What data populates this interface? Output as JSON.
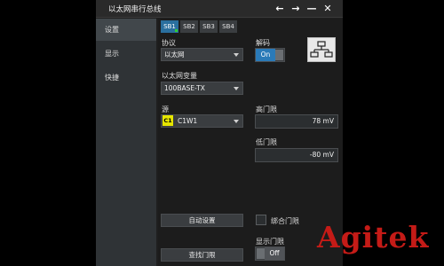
{
  "window": {
    "title": "以太网串行总线",
    "controls": [
      "←",
      "→",
      "—",
      "✕"
    ]
  },
  "nav": {
    "items": [
      {
        "label": "设置",
        "active": true
      },
      {
        "label": "显示",
        "active": false
      },
      {
        "label": "快捷",
        "active": false
      }
    ]
  },
  "tabs": [
    {
      "label": "SB1",
      "active": true
    },
    {
      "label": "SB2",
      "active": false
    },
    {
      "label": "SB3",
      "active": false
    },
    {
      "label": "SB4",
      "active": false
    }
  ],
  "protocol": {
    "label": "协议",
    "value": "以太网"
  },
  "decode": {
    "label": "解码",
    "state": "On"
  },
  "variant": {
    "label": "以太网变量",
    "value": "100BASE-TX"
  },
  "source": {
    "label": "源",
    "badge": "C1",
    "value": "C1W1",
    "badge_color": "#e6e600"
  },
  "high_threshold": {
    "label": "高门限",
    "value": "78 mV"
  },
  "low_threshold": {
    "label": "低门限",
    "value": "-80 mV"
  },
  "auto_setup": {
    "label": "自动设置"
  },
  "bind_thresholds": {
    "label": "绑合门限"
  },
  "show_threshold": {
    "label": "显示门限",
    "state": "Off"
  },
  "find_threshold": {
    "label": "查找门限"
  },
  "icons": {
    "network": "network-icon"
  },
  "watermark": {
    "text": "Agitek",
    "color": "#c41b17"
  }
}
